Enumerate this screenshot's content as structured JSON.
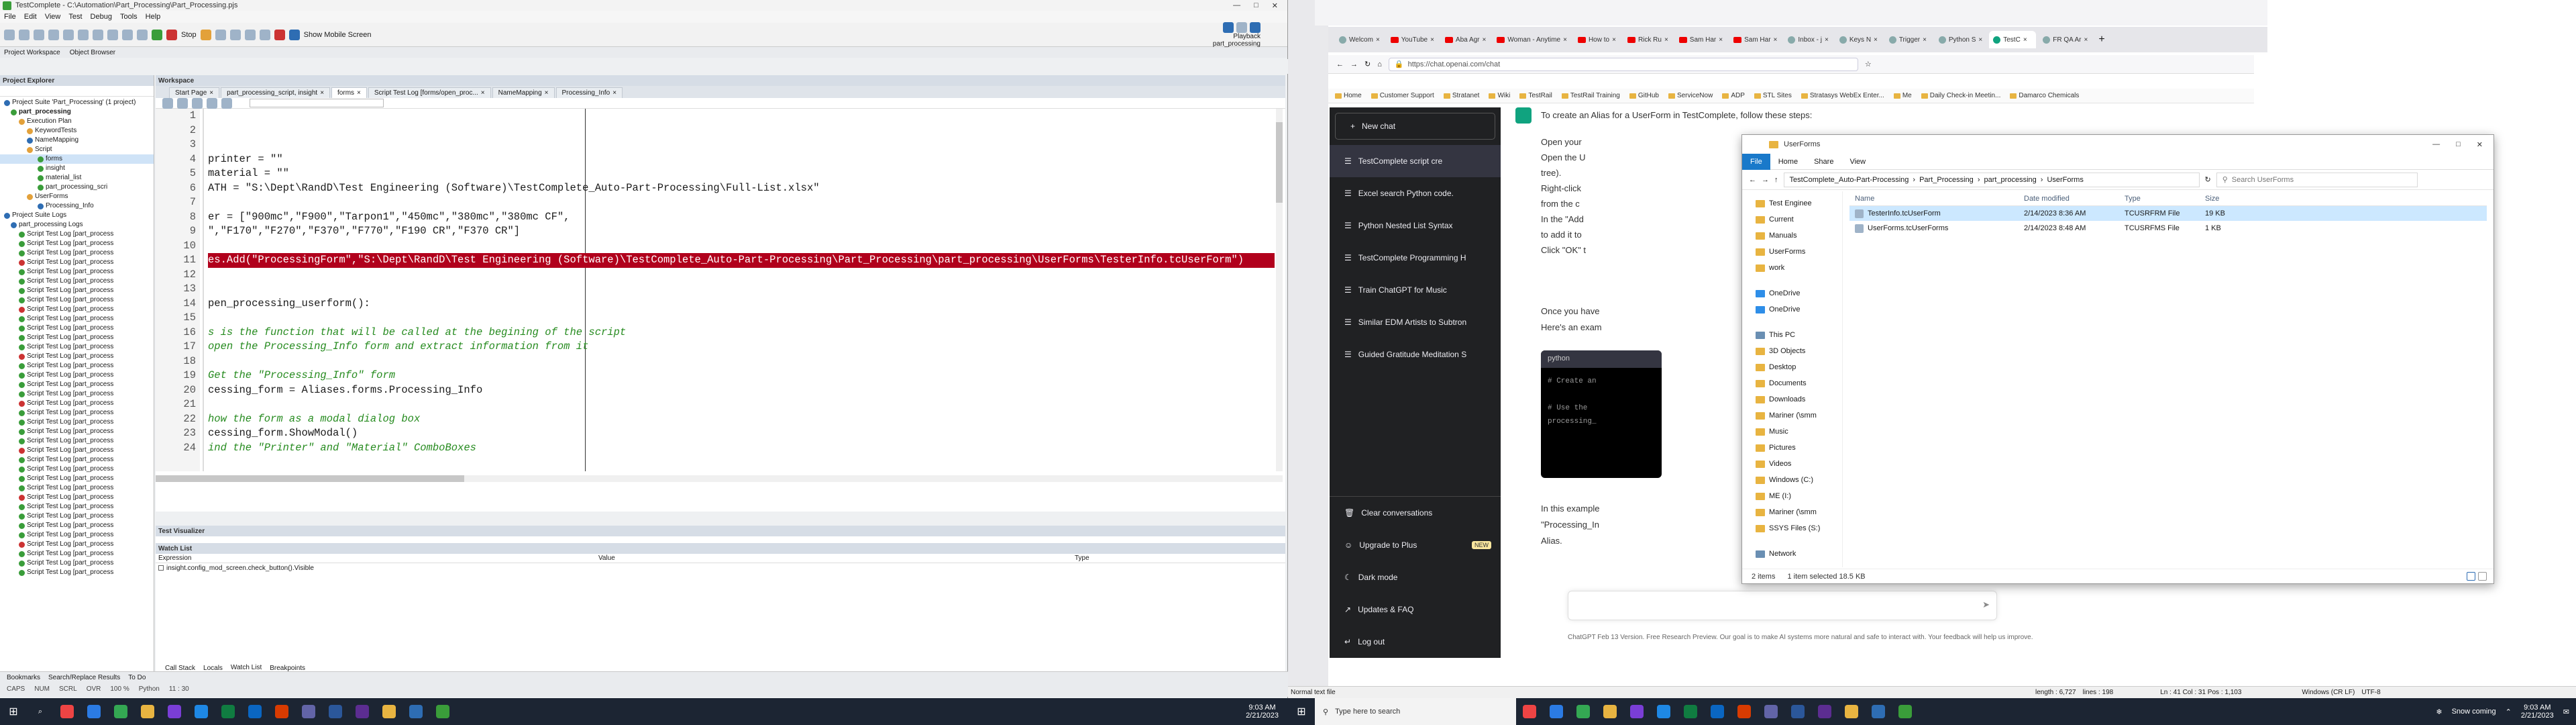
{
  "testcomplete": {
    "title": "TestComplete - C:\\Automation\\Part_Processing\\Part_Processing.pjs",
    "menu": [
      "File",
      "Edit",
      "View",
      "Test",
      "Debug",
      "Tools",
      "Help"
    ],
    "toolbar": {
      "stop_label": "Stop",
      "mobile_label": "Show Mobile Screen"
    },
    "playback_tooltip": {
      "title": "Playback",
      "subtitle": "part_processing"
    },
    "subbar": [
      "Project Workspace",
      "Object Browser"
    ],
    "project_explorer": {
      "title": "Project Explorer",
      "items": [
        "Project Suite 'Part_Processing' (1 project)",
        "part_processing",
        "Execution Plan",
        "KeywordTests",
        "NameMapping",
        "Script",
        "forms",
        "insight",
        "material_list",
        "part_processing_scri",
        "UserForms",
        "Processing_Info",
        "Project Suite Logs",
        "part_processing Logs"
      ],
      "log_item": "Script Test Log [part_process"
    },
    "workspace": {
      "title": "Workspace",
      "tabs": [
        "Start Page",
        "part_processing_script, insight",
        "forms",
        "Script Test Log [forms/open_proc...",
        "NameMapping",
        "Processing_Info"
      ],
      "line_numbers": [
        "1",
        "2",
        "3",
        "4",
        "5",
        "6",
        "7",
        "8",
        "9",
        "10",
        "11",
        "12",
        "13",
        "14",
        "15",
        "16",
        "17",
        "18",
        "19",
        "20",
        "21",
        "22",
        "23",
        "24"
      ],
      "code": [
        "",
        "",
        "",
        "printer = \"\"",
        "material = \"\"",
        "ATH = \"S:\\Dept\\RandD\\Test Engineering (Software)\\TestComplete_Auto-Part-Processing\\Full-List.xlsx\"",
        "",
        "er = [\"900mc\",\"F900\",\"Tarpon1\",\"450mc\",\"380mc\",\"380mc CF\",",
        "\",\"F170\",\"F270\",\"F370\",\"F770\",\"F190 CR\",\"F370 CR\"]",
        "",
        "es.Add(\"ProcessingForm\",\"S:\\Dept\\RandD\\Test Engineering (Software)\\TestComplete_Auto-Part-Processing\\Part_Processing\\part_processing\\UserForms\\TesterInfo.tcUserForm\")",
        "",
        "",
        "pen_processing_userform():",
        "",
        "s is the function that will be called at the begining of the script",
        "open the Processing_Info form and extract information from it",
        "",
        "Get the \"Processing_Info\" form",
        "cessing_form = Aliases.forms.Processing_Info",
        "",
        "how the form as a modal dialog box",
        "cessing_form.ShowModal()",
        "ind the \"Printer\" and \"Material\" ComboBoxes"
      ]
    },
    "visualizer": {
      "title": "Test Visualizer"
    },
    "watch": {
      "title": "Watch List",
      "columns": [
        "Expression",
        "Value",
        "Type"
      ],
      "row": "insight.config_mod_screen.check_button().Visible"
    },
    "bottom_tabs": [
      "Call Stack",
      "Locals",
      "Watch List",
      "Breakpoints"
    ],
    "bottom_tabs2": [
      "Bookmarks",
      "Search/Replace Results",
      "To Do"
    ],
    "status": {
      "caps": "CAPS",
      "num": "NUM",
      "scrl": "SCRL",
      "ovr": "OVR",
      "zoom": "100 %",
      "python": "Python",
      "pos": "11 : 30"
    }
  },
  "browser": {
    "tabs": [
      "Welcom",
      "YouTube",
      "Aba Agr",
      "Woman - Anytime",
      "How to",
      "Rick Ru",
      "Sam Har",
      "Sam Har",
      "Inbox - j",
      "Keys N",
      "Trigger",
      "Python S",
      "TestC",
      "FR QA Ar"
    ],
    "url": "https://chat.openai.com/chat",
    "bookmarks": [
      "Home",
      "Customer Support",
      "Stratanet",
      "Wiki",
      "TestRail",
      "TestRail Training",
      "GitHub",
      "ServiceNow",
      "ADP",
      "STL Sites",
      "Stratasys WebEx Enter...",
      "Me",
      "Daily Check-in Meetin...",
      "Damarco Chemicals"
    ]
  },
  "chatgpt": {
    "new_chat": "New chat",
    "history": [
      "TestComplete script cre",
      "Excel search Python code.",
      "Python Nested List Syntax",
      "TestComplete Programming H",
      "Train ChatGPT for Music",
      "Similar EDM Artists to Subtron",
      "Guided Gratitude Meditation S"
    ],
    "bottom": [
      "Clear conversations",
      "Upgrade to Plus",
      "Dark mode",
      "Updates & FAQ",
      "Log out"
    ],
    "new_badge": "NEW",
    "intro": "To create an Alias for a UserForm in TestComplete, follow these steps:",
    "steps": [
      "Open your",
      "Open the U",
      "tree).",
      "Right-click",
      "from the c",
      "In the \"Add",
      "to add it to",
      "Click \"OK\" t"
    ],
    "p1": "Once you have",
    "p2": "Here's an exam",
    "code_lang": "python",
    "code_lines": [
      "# Create an",
      "",
      "# Use the",
      "processing_"
    ],
    "p3": "In this example",
    "p4": "\"Processing_In",
    "p5": "Alias.",
    "footer": "ChatGPT Feb 13 Version. Free Research Preview. Our goal is to make AI systems more natural and safe to interact with. Your feedback will help us improve."
  },
  "explorer": {
    "title": "UserForms",
    "ribbon": [
      "File",
      "Home",
      "Share",
      "View"
    ],
    "path": [
      "TestComplete_Auto-Part-Processing",
      "Part_Processing",
      "part_processing",
      "UserForms"
    ],
    "search_placeholder": "Search UserForms",
    "nav": [
      "Test Enginee",
      "Current",
      "Manuals",
      "UserForms",
      "work",
      "OneDrive",
      "OneDrive",
      "This PC",
      "3D Objects",
      "Desktop",
      "Documents",
      "Downloads",
      "Mariner (\\smm",
      "Music",
      "Pictures",
      "Videos",
      "Windows (C:)",
      "ME (I:)",
      "Mariner (\\smm",
      "SSYS Files (S:)",
      "Network"
    ],
    "columns": [
      "Name",
      "Date modified",
      "Type",
      "Size"
    ],
    "files": [
      {
        "name": "TesterInfo.tcUserForm",
        "date": "2/14/2023 8:36 AM",
        "type": "TCUSRFRM File",
        "size": "19 KB"
      },
      {
        "name": "UserForms.tcUserForms",
        "date": "2/14/2023 8:48 AM",
        "type": "TCUSRFMS File",
        "size": "1 KB"
      }
    ],
    "status": [
      "2 items",
      "1 item selected  18.5 KB"
    ]
  },
  "browser_status": {
    "left": "Normal text file",
    "length": "length : 6,727",
    "lines": "lines : 198",
    "pos": "Ln : 41    Col : 31    Pos : 1,103",
    "eol": "Windows (CR LF)",
    "enc": "UTF-8"
  },
  "taskbar": {
    "search_placeholder": "Type here to search",
    "weather": "Snow coming",
    "time": "9:03 AM",
    "date": "2/21/2023",
    "time2": "9:03 AM",
    "date2": "2/21/2023"
  }
}
